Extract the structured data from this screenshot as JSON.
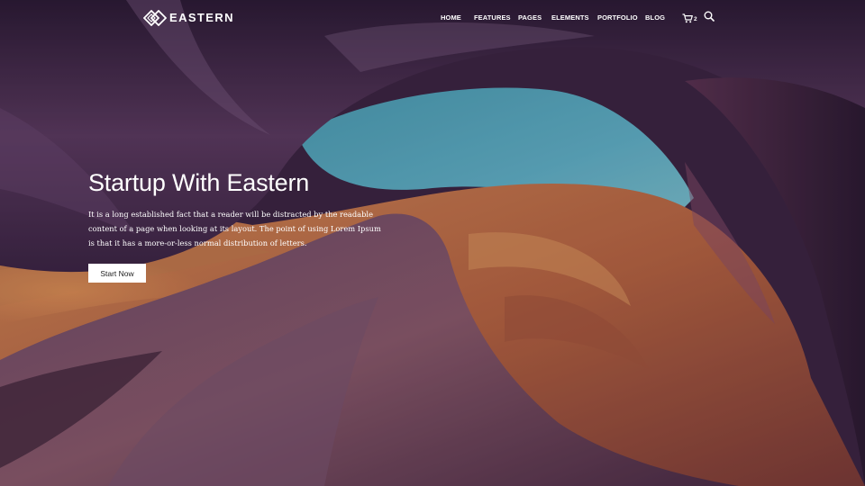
{
  "brand": {
    "name": "EASTERN",
    "logo_icon": "diamond-lattice-logo"
  },
  "nav": {
    "items": [
      {
        "label": "HOME"
      },
      {
        "label": "FEATURES"
      },
      {
        "label": "PAGES"
      },
      {
        "label": "ELEMENTS"
      },
      {
        "label": "PORTFOLIO"
      },
      {
        "label": "BLOG"
      }
    ],
    "cart": {
      "icon": "cart-icon",
      "count": "2"
    },
    "search": {
      "icon": "search-icon"
    }
  },
  "hero": {
    "title": "Startup With Eastern",
    "paragraph": "It is a long established fact that a reader will be distracted by the readable content of a page when looking at its layout. The point of using Lorem Ipsum is that it has a more-or-less normal distribution of letters.",
    "button_label": "Start Now",
    "background": "canyon sandstone photo"
  },
  "colors": {
    "text": "#ffffff",
    "button_bg": "#ffffff",
    "button_text": "#222222"
  }
}
